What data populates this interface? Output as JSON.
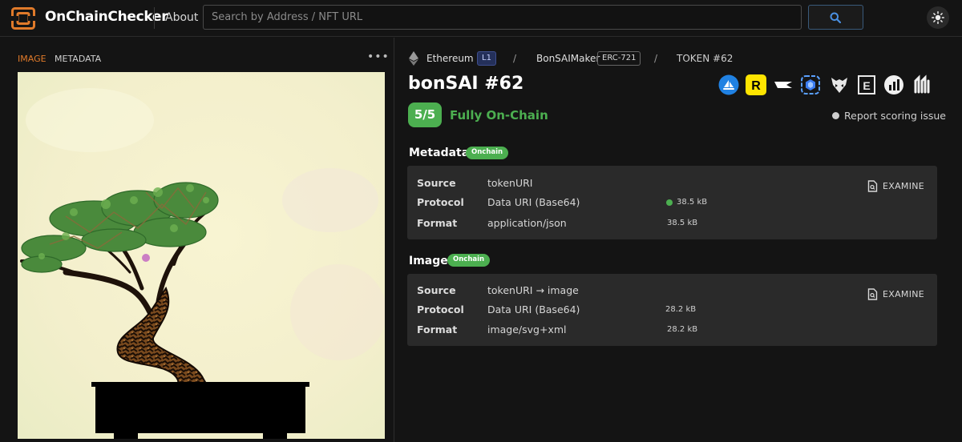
{
  "header": {
    "brand": "OnChainChecker",
    "about": "About",
    "search_placeholder": "Search by Address / NFT URL"
  },
  "colors": {
    "accent_orange": "#e07a2a",
    "success_green": "#4caf50",
    "background": "#141414",
    "card": "#2a2a2a"
  },
  "left": {
    "tabs": [
      "IMAGE",
      "METADATA"
    ],
    "active_tab": "IMAGE",
    "more": "•••",
    "image_alt": "bonsai tree artwork"
  },
  "breadcrumb": {
    "chain": "Ethereum",
    "chain_layer": "L1",
    "separator": "/",
    "collection": "BonSAIMaker",
    "standard": "ERC-721",
    "token": "TOKEN #62"
  },
  "nft": {
    "title": "bonSAI #62",
    "score": "5/5",
    "score_label": "Fully On-Chain",
    "report": "Report scoring issue",
    "marketplaces": [
      "opensea-icon",
      "rarible-icon",
      "foundation-icon",
      "looksrare-icon",
      "x2y2-icon",
      "etherscan-icon",
      "dune-icon",
      "magiceden-icon"
    ]
  },
  "metadata": {
    "title": "Metadata",
    "badge": "Onchain",
    "rows": [
      {
        "key": "Source",
        "value": "tokenURI"
      },
      {
        "key": "Protocol",
        "value": "Data URI (Base64)",
        "size": "38.5 kB"
      },
      {
        "key": "Format",
        "value": "application/json",
        "size": "38.5 kB"
      }
    ],
    "examine": "EXAMINE"
  },
  "image": {
    "title": "Image",
    "badge": "Onchain",
    "rows": [
      {
        "key": "Source",
        "value": "tokenURI → image"
      },
      {
        "key": "Protocol",
        "value": "Data URI (Base64)",
        "size": "28.2 kB"
      },
      {
        "key": "Format",
        "value": "image/svg+xml",
        "size": "28.2 kB"
      }
    ],
    "examine": "EXAMINE"
  }
}
